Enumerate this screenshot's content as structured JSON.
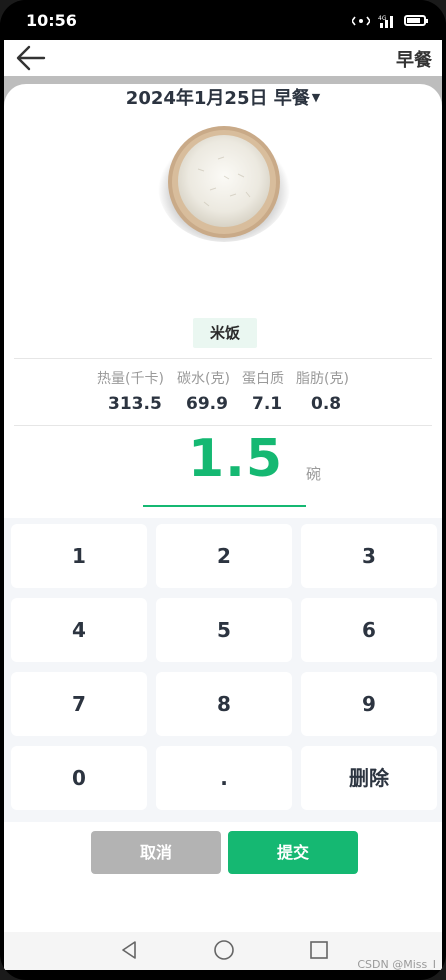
{
  "status_bar": {
    "time": "10:56",
    "network": "4G"
  },
  "header": {
    "title": "早餐"
  },
  "date_selector": {
    "label": "2024年1月25日 早餐"
  },
  "food": {
    "name": "米饭",
    "image": "rice-bowl-image"
  },
  "nutrition": {
    "labels": [
      "热量(千卡)",
      "碳水(克)",
      "蛋白质",
      "脂肪(克)"
    ],
    "values": [
      "313.5",
      "69.9",
      "7.1",
      "0.8"
    ]
  },
  "amount": {
    "value": "1.5",
    "unit": "碗"
  },
  "keypad": {
    "keys": [
      "1",
      "2",
      "3",
      "4",
      "5",
      "6",
      "7",
      "8",
      "9",
      "0",
      ".",
      "删除"
    ]
  },
  "actions": {
    "cancel": "取消",
    "submit": "提交"
  },
  "watermark": "CSDN @Miss_I",
  "colors": {
    "accent": "#15b872",
    "text": "#2c3440",
    "cancel": "#b3b3b3"
  },
  "icons": [
    "back-arrow-icon",
    "signal-icon",
    "battery-icon",
    "nav-back-icon",
    "nav-home-icon",
    "nav-recents-icon"
  ]
}
